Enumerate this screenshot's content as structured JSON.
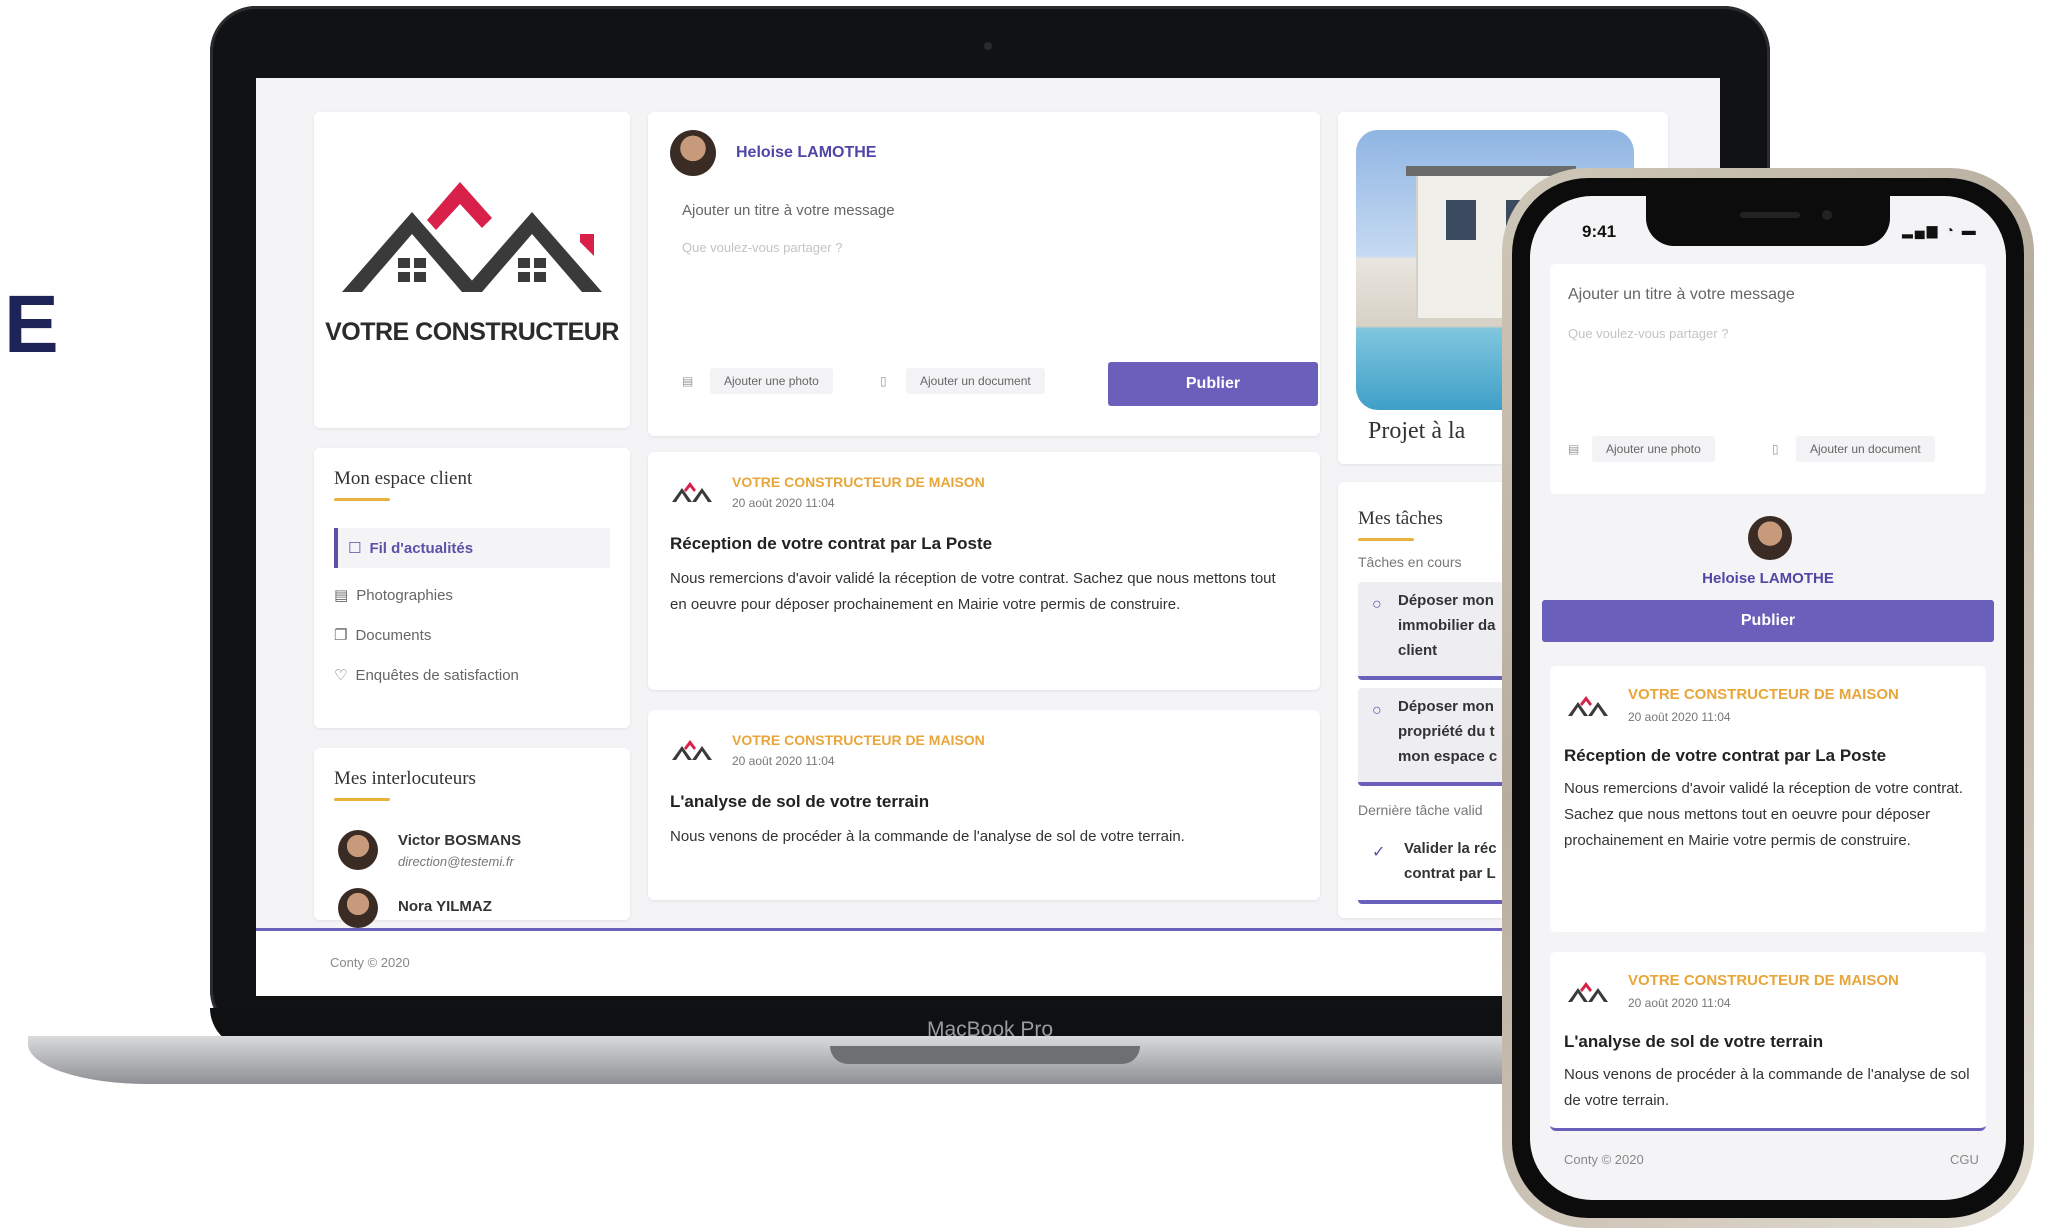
{
  "side_letter": "E",
  "laptop": {
    "brand_label": "MacBook Pro",
    "logo_text": "VOTRE CONSTRUCTEUR",
    "composer": {
      "author": "Heloise LAMOTHE",
      "title_placeholder": "Ajouter un titre à votre message",
      "body_placeholder": "Que voulez-vous partager ?",
      "add_photo": "Ajouter une photo",
      "add_document": "Ajouter un document",
      "publish": "Publier"
    },
    "menu": {
      "heading": "Mon espace client",
      "items": [
        "Fil d'actualités",
        "Photographies",
        "Documents",
        "Enquêtes de satisfaction"
      ]
    },
    "contacts": {
      "heading": "Mes interlocuteurs",
      "people": [
        {
          "name": "Victor BOSMANS",
          "email": "direction@testemi.fr"
        },
        {
          "name": "Nora YILMAZ",
          "email": ""
        }
      ]
    },
    "news": [
      {
        "brand": "VOTRE CONSTRUCTEUR DE MAISON",
        "date": "20 août 2020 11:04",
        "title": "Réception de votre contrat par La Poste",
        "body": "Nous remercions d'avoir validé la réception de votre contrat. Sachez que nous mettons tout en oeuvre pour déposer prochainement en Mairie votre permis de construire."
      },
      {
        "brand": "VOTRE CONSTRUCTEUR DE MAISON",
        "date": "20 août 2020 11:04",
        "title": "L'analyse de sol de votre terrain",
        "body": "Nous venons de procéder à la commande de l'analyse de sol de votre terrain."
      }
    ],
    "project_label": "Projet à la",
    "tasks": {
      "heading": "Mes tâches",
      "in_progress_label": "Tâches en cours",
      "items": [
        [
          "Déposer mon",
          "immobilier da",
          "client"
        ],
        [
          "Déposer mon",
          "propriété du t",
          "mon espace c"
        ]
      ],
      "last_validated_label": "Dernière tâche valid",
      "last_validated": [
        "Valider la réc",
        "contrat par L"
      ]
    },
    "footer": "Conty © 2020"
  },
  "phone": {
    "time": "9:41",
    "status_icons": "signal wifi battery",
    "composer": {
      "title_placeholder": "Ajouter un titre à votre message",
      "body_placeholder": "Que voulez-vous partager ?",
      "add_photo": "Ajouter une photo",
      "add_document": "Ajouter un document",
      "author": "Heloise LAMOTHE",
      "publish": "Publier"
    },
    "news": [
      {
        "brand": "VOTRE CONSTRUCTEUR DE MAISON",
        "date": "20 août 2020 11:04",
        "title": "Réception de votre contrat par La Poste",
        "body": "Nous remercions d'avoir validé la réception de votre contrat. Sachez que nous mettons tout en oeuvre pour déposer prochainement en Mairie votre permis de construire."
      },
      {
        "brand": "VOTRE CONSTRUCTEUR DE MAISON",
        "date": "20 août 2020 11:04",
        "title": "L'analyse de sol de votre terrain",
        "body": "Nous venons de procéder à la commande de l'analyse de sol de votre terrain."
      }
    ],
    "footer_left": "Conty © 2020",
    "footer_right": "CGU"
  },
  "colors": {
    "accent": "#6a5fba",
    "brand_orange": "#e8a63a",
    "logo_red": "#d8204a",
    "logo_dark": "#3a3a3a"
  }
}
